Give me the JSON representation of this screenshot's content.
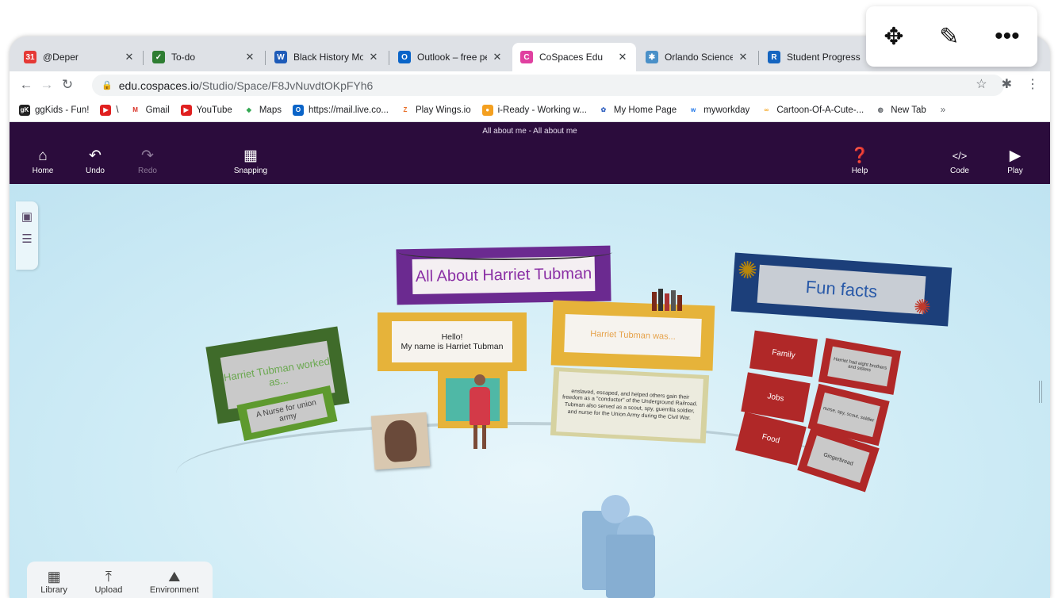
{
  "browser": {
    "tabs": [
      {
        "title": "@Deper",
        "icon": "calendar-icon",
        "color": "#e53935",
        "active": false
      },
      {
        "title": "To-do",
        "icon": "todo-icon",
        "color": "#2e7d32",
        "active": false
      },
      {
        "title": "Black History Mo",
        "icon": "word-icon",
        "color": "#1e5bb8",
        "active": false
      },
      {
        "title": "Outlook – free pe",
        "icon": "outlook-icon",
        "color": "#0a64c8",
        "active": false
      },
      {
        "title": "CoSpaces Edu",
        "icon": "cospaces-icon",
        "color": "#e040a0",
        "active": true
      },
      {
        "title": "Orlando Science",
        "icon": "science-icon",
        "color": "#4a90c8",
        "active": false
      },
      {
        "title": "Student Progress",
        "icon": "renaissance-icon",
        "color": "#1565c0",
        "active": false
      }
    ],
    "url_host": "edu.cospaces.io",
    "url_path": "/Studio/Space/F8JvNuvdtOKpFYh6",
    "bookmarks": [
      {
        "label": "ggKids - Fun!",
        "color": "#222222"
      },
      {
        "label": "\\",
        "color": "#e02020"
      },
      {
        "label": "Gmail",
        "color": "#d93025"
      },
      {
        "label": "YouTube",
        "color": "#e02020"
      },
      {
        "label": "Maps",
        "color": "#34a853"
      },
      {
        "label": "https://mail.live.co...",
        "color": "#0a64c8"
      },
      {
        "label": "Play Wings.io",
        "color": "#e8702a"
      },
      {
        "label": "i-Ready - Working w...",
        "color": "#f4a020"
      },
      {
        "label": "My Home Page",
        "color": "#3060c0"
      },
      {
        "label": "myworkday",
        "color": "#1a73e8"
      },
      {
        "label": "Cartoon-Of-A-Cute-...",
        "color": "#f5a623"
      },
      {
        "label": "New Tab",
        "color": "#5f6368"
      }
    ]
  },
  "app": {
    "title": "All about me - All about me",
    "buttons": {
      "home": "Home",
      "undo": "Undo",
      "redo": "Redo",
      "snapping": "Snapping",
      "help": "Help",
      "code": "Code",
      "play": "Play"
    },
    "dock": {
      "library": "Library",
      "upload": "Upload",
      "environment": "Environment"
    }
  },
  "scene": {
    "title_board": "All About  Harriet Tubman",
    "hello_board": "Hello!\nMy name is Harriet Tubman",
    "worked_board": "Harriet Tubman worked as...",
    "nurse_board": "A Nurse for union army",
    "was_board": "Harriet Tubman was...",
    "was_text": "enslaved, escaped, and helped others gain their freedom as a \"conductor\" of the Underground Railroad. Tubman also served as a scout, spy, guerrilla soldier, and nurse for the Union Army during the Civil War.",
    "fun_facts_title": "Fun facts",
    "facts": [
      {
        "label": "Family",
        "answer": "Harriet had eight brothers and sisters"
      },
      {
        "label": "Jobs",
        "answer": "nurse, spy, scout, soldier"
      },
      {
        "label": "Food",
        "answer": "Gingerbread"
      }
    ]
  },
  "colors": {
    "appbar": "#2b0c3c",
    "title_frame": "#6b2a90",
    "yellow_frame": "#e6b33a",
    "green_frame": "#3f6b2a",
    "red_card": "#b02828",
    "fun_frame": "#1c3f7a"
  }
}
